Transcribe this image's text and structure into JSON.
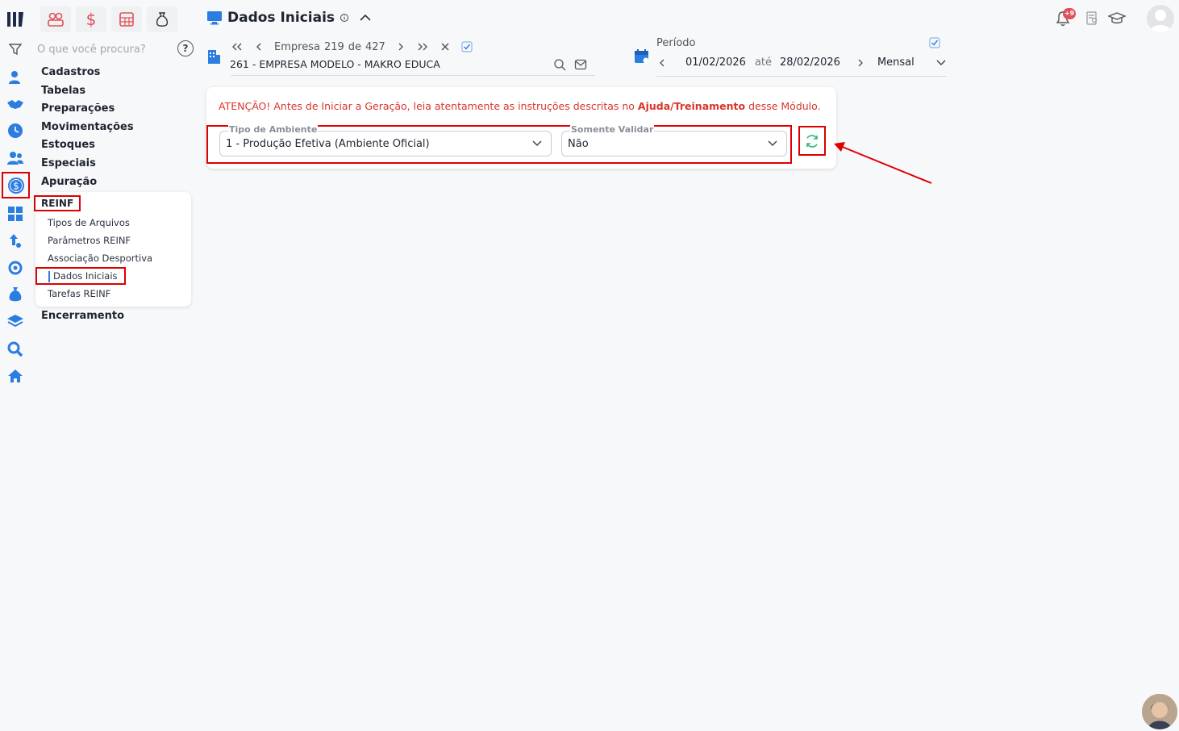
{
  "search": {
    "placeholder": "O que você procura?"
  },
  "menu": {
    "items": [
      "Cadastros",
      "Tabelas",
      "Preparações",
      "Movimentações",
      "Estoques",
      "Especiais",
      "Apuração"
    ],
    "submenu_header": "REINF",
    "submenu_items": [
      "Tipos de Arquivos",
      "Parâmetros REINF",
      "Associação Desportiva",
      "Dados Iniciais",
      "Tarefas REINF"
    ],
    "after": "Encerramento"
  },
  "header": {
    "title": "Dados Iniciais"
  },
  "empresa": {
    "nav_label": "Empresa",
    "current": "219",
    "sep": "de",
    "total": "427",
    "name": "261 - EMPRESA MODELO - MAKRO EDUCA"
  },
  "periodo": {
    "label": "Período",
    "start": "01/02/2026",
    "sep": "até",
    "end": "28/02/2026",
    "type": "Mensal"
  },
  "notifications": {
    "badge": "+9"
  },
  "card": {
    "warn_prefix": "ATENÇÃO! Antes de Iniciar a Geração, leia atentamente as instruções descritas no ",
    "warn_bold": "Ajuda/Treinamento",
    "warn_suffix": " desse Módulo.",
    "tipo_label": "Tipo de Ambiente",
    "tipo_value": "1 - Produção Efetiva (Ambiente Oficial)",
    "validar_label": "Somente Validar",
    "validar_value": "Não"
  },
  "colors": {
    "accent": "#2b7de0",
    "danger": "#d00000",
    "success": "#2eb872"
  }
}
